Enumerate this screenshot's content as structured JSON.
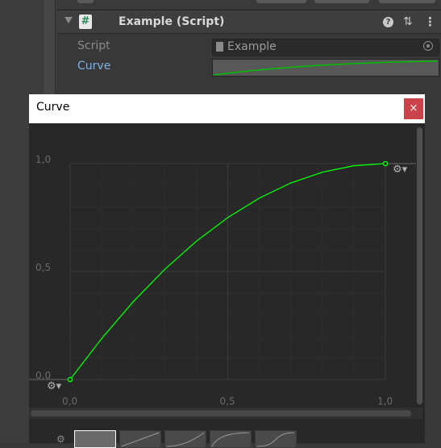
{
  "inspector": {
    "component_title": "Example (Script)",
    "fields": [
      {
        "label": "Script",
        "value": "Example"
      },
      {
        "label": "Curve"
      }
    ]
  },
  "curve_window": {
    "title": "Curve",
    "close_glyph": "×",
    "key_menu_icon": "gear-icon"
  },
  "chart_data": {
    "type": "line",
    "x_ticks": [
      "0,0",
      "0,5",
      "1,0"
    ],
    "y_ticks": [
      "0,0",
      "0,5",
      "1,0"
    ],
    "xlim": [
      0,
      1
    ],
    "ylim": [
      0,
      1
    ],
    "grid": true,
    "curve_color": "#00ff00",
    "keys": [
      {
        "x": 0,
        "y": 0
      },
      {
        "x": 1,
        "y": 1
      }
    ],
    "points": [
      {
        "x": 0.0,
        "y": 0.0
      },
      {
        "x": 0.1,
        "y": 0.19
      },
      {
        "x": 0.2,
        "y": 0.36
      },
      {
        "x": 0.3,
        "y": 0.51
      },
      {
        "x": 0.4,
        "y": 0.64
      },
      {
        "x": 0.5,
        "y": 0.75
      },
      {
        "x": 0.6,
        "y": 0.84
      },
      {
        "x": 0.7,
        "y": 0.91
      },
      {
        "x": 0.8,
        "y": 0.96
      },
      {
        "x": 0.9,
        "y": 0.99
      },
      {
        "x": 1.0,
        "y": 1.0
      }
    ]
  },
  "colors": {
    "accent_label": "#7fb2ea",
    "curve": "#00ff00",
    "close_button": "#c9434b"
  }
}
